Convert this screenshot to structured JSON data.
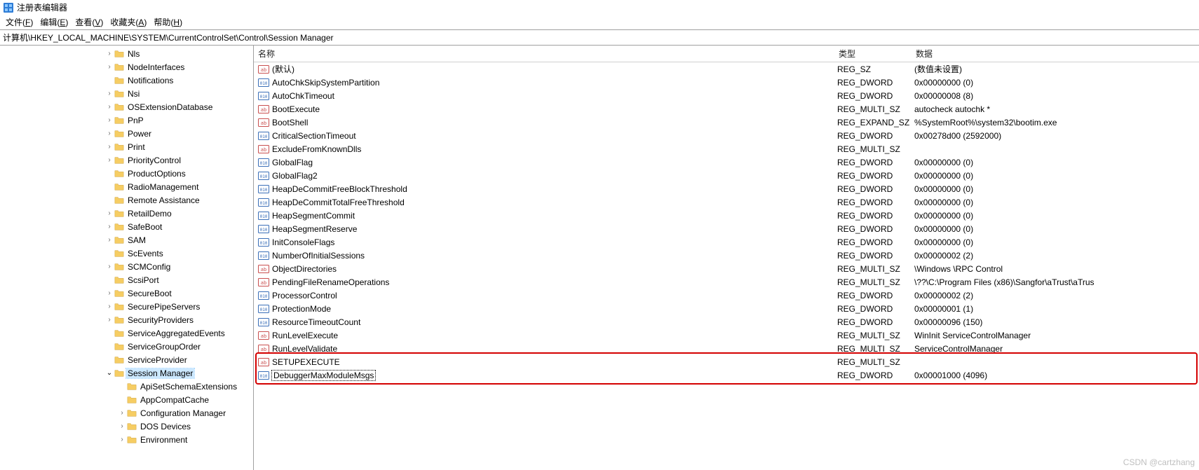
{
  "title": "注册表编辑器",
  "menus": [
    "文件(F)",
    "编辑(E)",
    "查看(V)",
    "收藏夹(A)",
    "帮助(H)"
  ],
  "address": "计算机\\HKEY_LOCAL_MACHINE\\SYSTEM\\CurrentControlSet\\Control\\Session Manager",
  "tree": [
    {
      "indent": 5,
      "arrow": ">",
      "label": "Nls"
    },
    {
      "indent": 5,
      "arrow": ">",
      "label": "NodeInterfaces"
    },
    {
      "indent": 5,
      "arrow": "",
      "label": "Notifications"
    },
    {
      "indent": 5,
      "arrow": ">",
      "label": "Nsi"
    },
    {
      "indent": 5,
      "arrow": ">",
      "label": "OSExtensionDatabase"
    },
    {
      "indent": 5,
      "arrow": ">",
      "label": "PnP"
    },
    {
      "indent": 5,
      "arrow": ">",
      "label": "Power"
    },
    {
      "indent": 5,
      "arrow": ">",
      "label": "Print"
    },
    {
      "indent": 5,
      "arrow": ">",
      "label": "PriorityControl"
    },
    {
      "indent": 5,
      "arrow": "",
      "label": "ProductOptions"
    },
    {
      "indent": 5,
      "arrow": "",
      "label": "RadioManagement"
    },
    {
      "indent": 5,
      "arrow": "",
      "label": "Remote Assistance"
    },
    {
      "indent": 5,
      "arrow": ">",
      "label": "RetailDemo"
    },
    {
      "indent": 5,
      "arrow": ">",
      "label": "SafeBoot"
    },
    {
      "indent": 5,
      "arrow": ">",
      "label": "SAM"
    },
    {
      "indent": 5,
      "arrow": "",
      "label": "ScEvents"
    },
    {
      "indent": 5,
      "arrow": ">",
      "label": "SCMConfig"
    },
    {
      "indent": 5,
      "arrow": "",
      "label": "ScsiPort"
    },
    {
      "indent": 5,
      "arrow": ">",
      "label": "SecureBoot"
    },
    {
      "indent": 5,
      "arrow": ">",
      "label": "SecurePipeServers"
    },
    {
      "indent": 5,
      "arrow": ">",
      "label": "SecurityProviders"
    },
    {
      "indent": 5,
      "arrow": "",
      "label": "ServiceAggregatedEvents"
    },
    {
      "indent": 5,
      "arrow": "",
      "label": "ServiceGroupOrder"
    },
    {
      "indent": 5,
      "arrow": "",
      "label": "ServiceProvider"
    },
    {
      "indent": 5,
      "arrow": "v",
      "label": "Session Manager",
      "selected": true
    },
    {
      "indent": 6,
      "arrow": "",
      "label": "ApiSetSchemaExtensions"
    },
    {
      "indent": 6,
      "arrow": "",
      "label": "AppCompatCache"
    },
    {
      "indent": 6,
      "arrow": ">",
      "label": "Configuration Manager"
    },
    {
      "indent": 6,
      "arrow": ">",
      "label": "DOS Devices"
    },
    {
      "indent": 6,
      "arrow": ">",
      "label": "Environment"
    }
  ],
  "cols": {
    "name": "名称",
    "type": "类型",
    "data": "数据"
  },
  "values": [
    {
      "icon": "sz",
      "name": "(默认)",
      "type": "REG_SZ",
      "data": "(数值未设置)"
    },
    {
      "icon": "dw",
      "name": "AutoChkSkipSystemPartition",
      "type": "REG_DWORD",
      "data": "0x00000000 (0)"
    },
    {
      "icon": "dw",
      "name": "AutoChkTimeout",
      "type": "REG_DWORD",
      "data": "0x00000008 (8)"
    },
    {
      "icon": "sz",
      "name": "BootExecute",
      "type": "REG_MULTI_SZ",
      "data": "autocheck autochk *"
    },
    {
      "icon": "sz",
      "name": "BootShell",
      "type": "REG_EXPAND_SZ",
      "data": "%SystemRoot%\\system32\\bootim.exe"
    },
    {
      "icon": "dw",
      "name": "CriticalSectionTimeout",
      "type": "REG_DWORD",
      "data": "0x00278d00 (2592000)"
    },
    {
      "icon": "sz",
      "name": "ExcludeFromKnownDlls",
      "type": "REG_MULTI_SZ",
      "data": ""
    },
    {
      "icon": "dw",
      "name": "GlobalFlag",
      "type": "REG_DWORD",
      "data": "0x00000000 (0)"
    },
    {
      "icon": "dw",
      "name": "GlobalFlag2",
      "type": "REG_DWORD",
      "data": "0x00000000 (0)"
    },
    {
      "icon": "dw",
      "name": "HeapDeCommitFreeBlockThreshold",
      "type": "REG_DWORD",
      "data": "0x00000000 (0)"
    },
    {
      "icon": "dw",
      "name": "HeapDeCommitTotalFreeThreshold",
      "type": "REG_DWORD",
      "data": "0x00000000 (0)"
    },
    {
      "icon": "dw",
      "name": "HeapSegmentCommit",
      "type": "REG_DWORD",
      "data": "0x00000000 (0)"
    },
    {
      "icon": "dw",
      "name": "HeapSegmentReserve",
      "type": "REG_DWORD",
      "data": "0x00000000 (0)"
    },
    {
      "icon": "dw",
      "name": "InitConsoleFlags",
      "type": "REG_DWORD",
      "data": "0x00000000 (0)"
    },
    {
      "icon": "dw",
      "name": "NumberOfInitialSessions",
      "type": "REG_DWORD",
      "data": "0x00000002 (2)"
    },
    {
      "icon": "sz",
      "name": "ObjectDirectories",
      "type": "REG_MULTI_SZ",
      "data": "\\Windows \\RPC Control"
    },
    {
      "icon": "sz",
      "name": "PendingFileRenameOperations",
      "type": "REG_MULTI_SZ",
      "data": "\\??\\C:\\Program Files (x86)\\Sangfor\\aTrust\\aTrus"
    },
    {
      "icon": "dw",
      "name": "ProcessorControl",
      "type": "REG_DWORD",
      "data": "0x00000002 (2)"
    },
    {
      "icon": "dw",
      "name": "ProtectionMode",
      "type": "REG_DWORD",
      "data": "0x00000001 (1)"
    },
    {
      "icon": "dw",
      "name": "ResourceTimeoutCount",
      "type": "REG_DWORD",
      "data": "0x00000096 (150)"
    },
    {
      "icon": "sz",
      "name": "RunLevelExecute",
      "type": "REG_MULTI_SZ",
      "data": "WinInit ServiceControlManager"
    },
    {
      "icon": "sz",
      "name": "RunLevelValidate",
      "type": "REG_MULTI_SZ",
      "data": "ServiceControlManager"
    },
    {
      "icon": "sz",
      "name": "SETUPEXECUTE",
      "type": "REG_MULTI_SZ",
      "data": ""
    },
    {
      "icon": "dw",
      "name": "DebuggerMaxModuleMsgs",
      "type": "REG_DWORD",
      "data": "0x00001000 (4096)",
      "box": true
    }
  ],
  "watermark": "CSDN @cartzhang"
}
